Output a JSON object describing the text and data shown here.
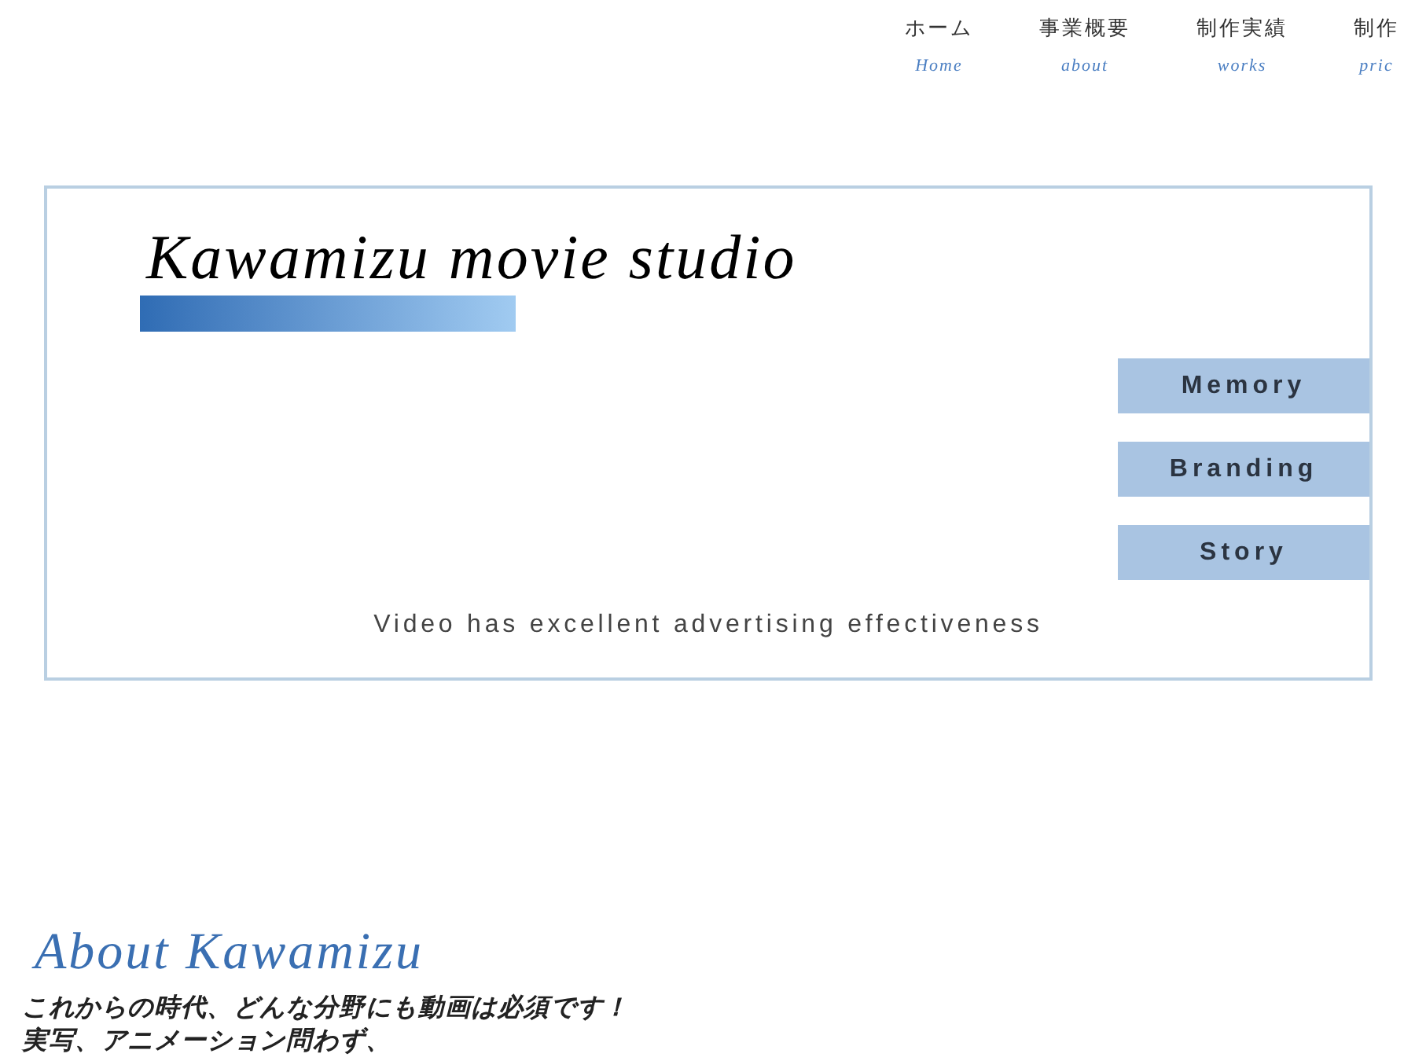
{
  "nav": [
    {
      "label": "ホーム",
      "sublabel": "Home"
    },
    {
      "label": "事業概要",
      "sublabel": "about"
    },
    {
      "label": "制作実績",
      "sublabel": "works"
    },
    {
      "label": "制作",
      "sublabel": "pric"
    }
  ],
  "hero": {
    "title": "Kawamizu movie studio",
    "buttons": [
      "Memory",
      "Branding",
      "Story"
    ],
    "tagline": "Video has excellent advertising effectiveness"
  },
  "about": {
    "heading": "About Kawamizu",
    "lines": [
      "これからの時代、どんな分野にも動画は必須です！",
      "実写、アニメーション問わず、"
    ]
  }
}
